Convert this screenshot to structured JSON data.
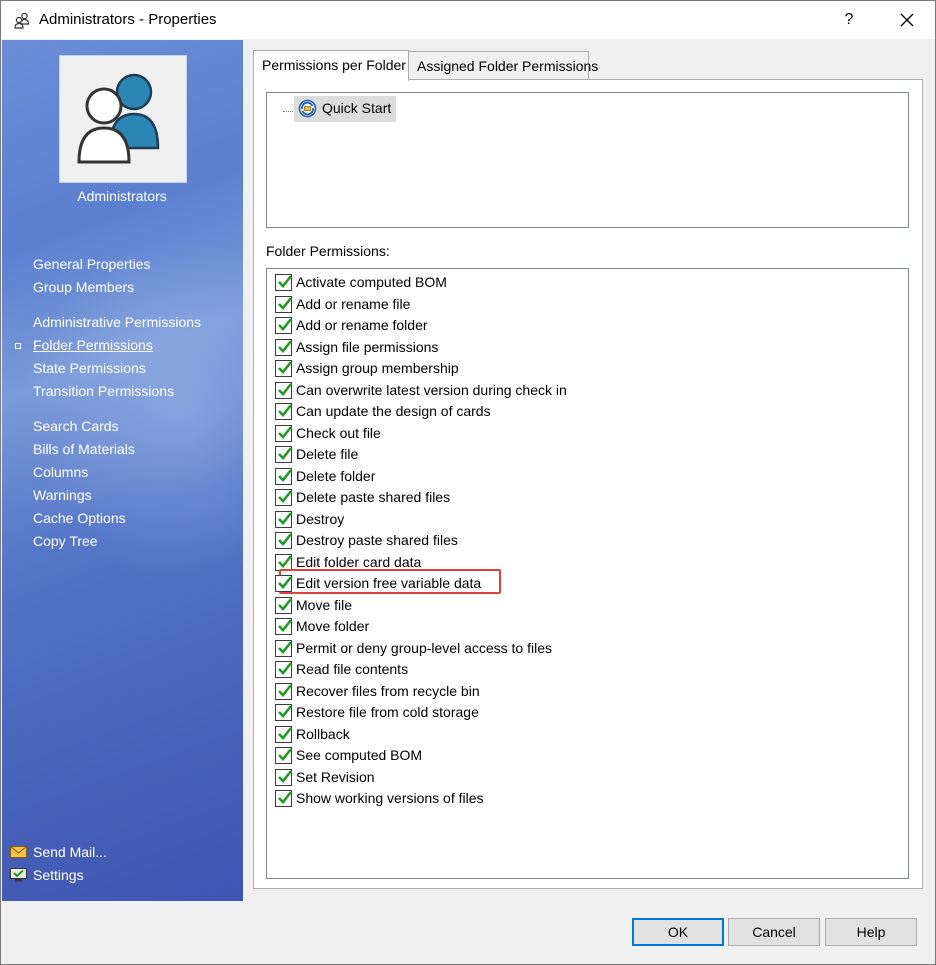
{
  "window": {
    "title": "Administrators - Properties",
    "help_label": "?"
  },
  "sidebar": {
    "group_name": "Administrators",
    "nav_items": [
      {
        "label": "General Properties"
      },
      {
        "label": "Group Members"
      },
      {
        "label": "Administrative Permissions"
      },
      {
        "label": "Folder Permissions",
        "active": true
      },
      {
        "label": "State Permissions"
      },
      {
        "label": "Transition Permissions"
      },
      {
        "label": "Search Cards"
      },
      {
        "label": "Bills of Materials"
      },
      {
        "label": "Columns"
      },
      {
        "label": "Warnings"
      },
      {
        "label": "Cache Options"
      },
      {
        "label": "Copy Tree"
      }
    ],
    "bottom_links": [
      {
        "label": "Send Mail...",
        "icon": "mail-icon"
      },
      {
        "label": "Settings",
        "icon": "settings-monitor-icon"
      }
    ]
  },
  "tabs": [
    {
      "label": "Permissions per Folder",
      "active": true
    },
    {
      "label": "Assigned Folder Permissions",
      "active": false
    }
  ],
  "folder_tree": {
    "root_label": "Quick Start",
    "root_icon": "vault-folder-icon"
  },
  "folder_permissions": {
    "label": "Folder Permissions:",
    "items": [
      {
        "label": "Activate computed BOM",
        "checked": true
      },
      {
        "label": "Add or rename file",
        "checked": true
      },
      {
        "label": "Add or rename folder",
        "checked": true
      },
      {
        "label": "Assign file permissions",
        "checked": true
      },
      {
        "label": "Assign group membership",
        "checked": true
      },
      {
        "label": "Can overwrite latest version during check in",
        "checked": true
      },
      {
        "label": "Can update the design of cards",
        "checked": true
      },
      {
        "label": "Check out file",
        "checked": true
      },
      {
        "label": "Delete file",
        "checked": true
      },
      {
        "label": "Delete folder",
        "checked": true
      },
      {
        "label": "Delete paste shared files",
        "checked": true
      },
      {
        "label": "Destroy",
        "checked": true
      },
      {
        "label": "Destroy paste shared files",
        "checked": true
      },
      {
        "label": "Edit folder card data",
        "checked": true
      },
      {
        "label": "Edit version free variable data",
        "checked": true,
        "highlighted": true
      },
      {
        "label": "Move file",
        "checked": true
      },
      {
        "label": "Move folder",
        "checked": true
      },
      {
        "label": "Permit or deny group-level access to files",
        "checked": true
      },
      {
        "label": "Read file contents",
        "checked": true
      },
      {
        "label": "Recover files from recycle bin",
        "checked": true
      },
      {
        "label": "Restore file from cold storage",
        "checked": true
      },
      {
        "label": "Rollback",
        "checked": true
      },
      {
        "label": "See computed BOM",
        "checked": true
      },
      {
        "label": "Set Revision",
        "checked": true
      },
      {
        "label": "Show working versions of files",
        "checked": true
      }
    ]
  },
  "buttons": {
    "ok": "OK",
    "cancel": "Cancel",
    "help": "Help"
  },
  "colors": {
    "sidebar_blue": "#5676c8",
    "check_green": "#1f9d1f",
    "highlight_red": "#e0413e",
    "default_button_border": "#0078d7"
  }
}
